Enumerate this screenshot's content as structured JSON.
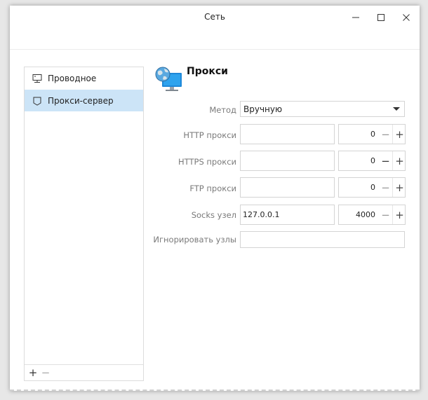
{
  "window": {
    "title": "Сеть",
    "controls": {
      "minimize": "minimize",
      "maximize": "maximize",
      "close": "close"
    }
  },
  "sidebar": {
    "items": [
      {
        "label": "Проводное",
        "icon": "wired-network-icon",
        "active": false
      },
      {
        "label": "Прокси-сервер",
        "icon": "proxy-icon",
        "active": true
      }
    ],
    "add_label": "+",
    "remove_label": "−"
  },
  "main": {
    "heading": "Прокси",
    "heading_icon": "globe-monitor-icon",
    "method": {
      "label": "Метод",
      "value": "Вручную"
    },
    "http": {
      "label": "HTTP прокси",
      "host": "",
      "port": "0"
    },
    "https": {
      "label": "HTTPS прокси",
      "host": "",
      "port": "0"
    },
    "ftp": {
      "label": "FTP прокси",
      "host": "",
      "port": "0"
    },
    "socks": {
      "label": "Socks узел",
      "host": "127.0.0.1",
      "port": "4000"
    },
    "ignore": {
      "label": "Игнорировать узлы",
      "value": ""
    },
    "spin_minus": "−",
    "spin_plus": "+"
  },
  "colors": {
    "selection": "#cce4f7",
    "label_gray": "#7a7a7a",
    "border": "#d4d4d4"
  }
}
